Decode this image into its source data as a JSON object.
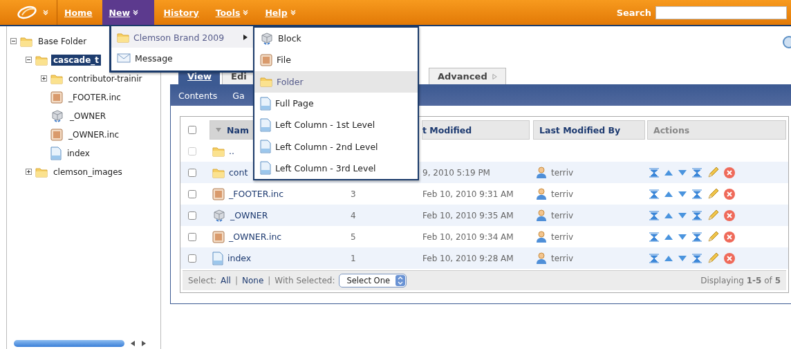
{
  "nav": {
    "items": [
      {
        "label": "Home",
        "selected": false,
        "has_menu": false
      },
      {
        "label": "New",
        "selected": true,
        "has_menu": true
      },
      {
        "label": "History",
        "selected": false,
        "has_menu": false
      },
      {
        "label": "Tools",
        "selected": false,
        "has_menu": true
      },
      {
        "label": "Help",
        "selected": false,
        "has_menu": true
      }
    ],
    "search": {
      "label": "Search"
    }
  },
  "tree": [
    {
      "label": "Base Folder",
      "kind": "folder",
      "expanded": true,
      "selected": false,
      "children": [
        {
          "label": "cascade_t",
          "kind": "folder",
          "expanded": true,
          "selected": true,
          "children": [
            {
              "label": "contributor-trainir",
              "kind": "folder",
              "expanded": false,
              "selected": false
            },
            {
              "label": "_FOOTER.inc",
              "kind": "file",
              "selected": false
            },
            {
              "label": "_OWNER",
              "kind": "block",
              "selected": false
            },
            {
              "label": "_OWNER.inc",
              "kind": "file",
              "selected": false
            },
            {
              "label": "index",
              "kind": "page",
              "selected": false
            }
          ]
        },
        {
          "label": "clemson_images",
          "kind": "folder",
          "expanded": false,
          "selected": false
        }
      ]
    }
  ],
  "tabs": [
    {
      "label": "View",
      "selected": true
    },
    {
      "label": "Edi",
      "selected": false
    },
    {
      "label": "Advanced",
      "selected": false
    }
  ],
  "subtabs": [
    {
      "label": "Contents"
    },
    {
      "label": "Ga"
    }
  ],
  "table": {
    "header_checked": false,
    "columns": [
      {
        "label": "Nam",
        "sorted": true,
        "sortable": true
      },
      {
        "label": "t Modified",
        "sorted": false,
        "sortable": true
      },
      {
        "label": "Last Modified By",
        "sorted": false,
        "sortable": true
      },
      {
        "label": "Actions",
        "sorted": false,
        "sortable": false
      }
    ],
    "rows": [
      {
        "kind": "folder",
        "name": "..",
        "checked": false,
        "checkbox_disabled": true
      },
      {
        "kind": "folder",
        "name": "cont",
        "date": "9, 2010 5:19 PM",
        "by": "terriv",
        "checked": false,
        "checkbox_disabled": false
      },
      {
        "kind": "file",
        "name": "_FOOTER.inc",
        "order": "3",
        "date": "Feb 10, 2010 9:31 AM",
        "by": "terriv",
        "checked": false,
        "checkbox_disabled": false
      },
      {
        "kind": "block",
        "name": "_OWNER",
        "order": "4",
        "date": "Feb 10, 2010 9:35 AM",
        "by": "terriv",
        "checked": false,
        "checkbox_disabled": false
      },
      {
        "kind": "file",
        "name": "_OWNER.inc",
        "order": "5",
        "date": "Feb 10, 2010 9:34 AM",
        "by": "terriv",
        "checked": false,
        "checkbox_disabled": false
      },
      {
        "kind": "page",
        "name": "index",
        "order": "1",
        "date": "Feb 10, 2010 9:28 AM",
        "by": "terriv",
        "checked": false,
        "checkbox_disabled": false
      }
    ],
    "footer": {
      "select_label": "Select:",
      "all": "All",
      "separator_1": "|",
      "none": "None",
      "separator_2": "|",
      "with_selected": "With Selected:",
      "dropdown": "Select One",
      "displaying": "Displaying **1-5** of **5**"
    }
  },
  "menu": {
    "items": [
      {
        "label": "Clemson Brand 2009",
        "kind": "folder",
        "submenu": true,
        "selected": true
      },
      {
        "label": "Message",
        "kind": "message",
        "submenu": false,
        "selected": false
      }
    ]
  },
  "submenu": {
    "items": [
      {
        "label": "Block",
        "kind": "block",
        "selected": false
      },
      {
        "label": "File",
        "kind": "file",
        "selected": false
      },
      {
        "label": "Folder",
        "kind": "folder",
        "selected": true
      },
      {
        "label": "Full Page",
        "kind": "page",
        "selected": false
      },
      {
        "label": "Left Column - 1st Level",
        "kind": "page",
        "selected": false
      },
      {
        "label": "Left Column - 2nd Level",
        "kind": "page",
        "selected": false
      },
      {
        "label": "Left Column - 3rd Level",
        "kind": "page",
        "selected": false
      }
    ]
  }
}
